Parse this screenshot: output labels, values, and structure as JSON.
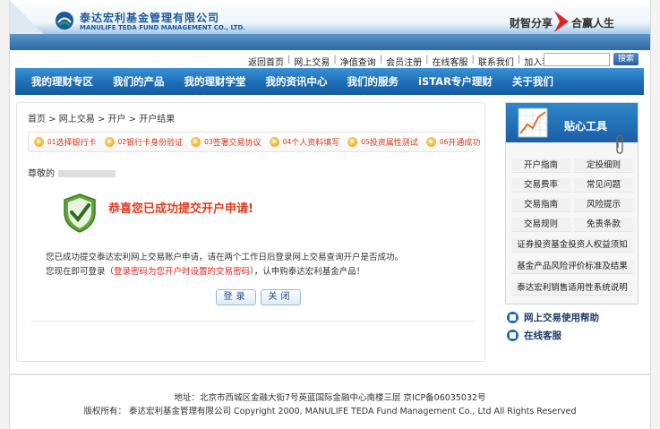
{
  "header": {
    "logo_cn": "泰达宏利基金管理有限公司",
    "logo_en": "MANULIFE TEDA FUND MANAGEMENT CO., LTD.",
    "slogan_left": "财智分享",
    "slogan_right": "合赢人生"
  },
  "top_links": [
    "返回首页",
    "网上交易",
    "净值查询",
    "会员注册",
    "在线客服",
    "联系我们",
    "加入我们"
  ],
  "search": {
    "placeholder": "",
    "button": "搜索"
  },
  "nav": [
    "我的理财专区",
    "我们的产品",
    "我的理财学堂",
    "我的资讯中心",
    "我们的服务",
    "iSTAR专户理财",
    "关于我们"
  ],
  "breadcrumb": "首页 > 网上交易 > 开户 > 开户结果",
  "steps": [
    {
      "num": "01",
      "label": "选择银行卡"
    },
    {
      "num": "02",
      "label": "银行卡身份验证"
    },
    {
      "num": "03",
      "label": "签署交易协议"
    },
    {
      "num": "04",
      "label": "个人资料填写"
    },
    {
      "num": "05",
      "label": "投资属性测试"
    },
    {
      "num": "06",
      "label": "开通成功"
    }
  ],
  "greeting": "尊敬的",
  "success_title": "恭喜您已成功提交开户申请!",
  "message1": "您已成功提交泰达宏利网上交易账户申请，请在两个工作日后登录网上交易查询开户是否成功。",
  "message2_a": "您现在即可登录（",
  "message2_red": "登录密码为您开户时设置的交易密码",
  "message2_b": "），认申购泰达宏利基金产品！",
  "buttons": {
    "login": "登录",
    "close": "关闭"
  },
  "tools": {
    "title": "贴心工具",
    "grid": [
      "开户指南",
      "定投细则",
      "交易费率",
      "常见问题",
      "交易指南",
      "风险提示",
      "交易规则",
      "免责条款"
    ],
    "wide": [
      "证券投资基金投资人权益须知",
      "基金产品风险评价标准及结果",
      "泰达宏利销售适用性系统说明"
    ]
  },
  "help_link": "网上交易使用帮助",
  "cs_link": "在线客服",
  "footer": {
    "address": "地址：北京市西城区金融大街7号英蓝国际金融中心南楼三层 京ICP备06035032号",
    "copyright": "版权所有：  泰达宏利基金管理有限公司  Copyright 2000, MANULIFE TEDA Fund Management Co., Ltd All Rights Reserved"
  }
}
